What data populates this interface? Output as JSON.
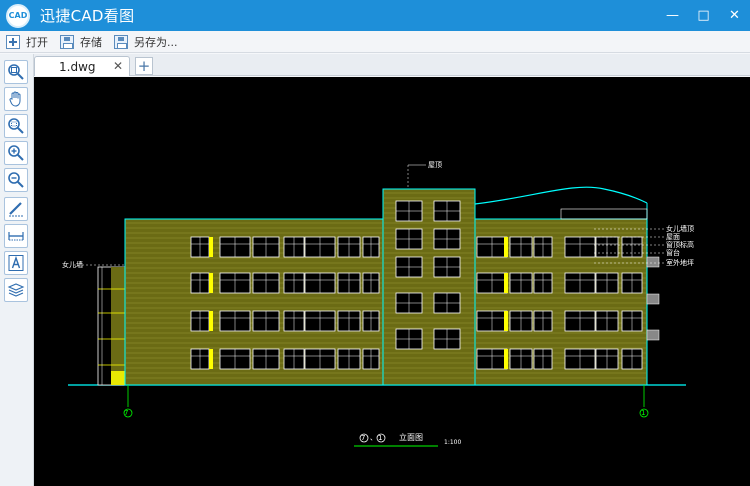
{
  "app": {
    "title": "迅捷CAD看图",
    "logo_text": "CAD"
  },
  "window_controls": {
    "minimize": "—",
    "maximize": "□",
    "close": "✕"
  },
  "toolbar": {
    "open_label": "打开",
    "save_label": "存储",
    "save_as_label": "另存为..."
  },
  "tabs": [
    {
      "label": "1.dwg",
      "close": "✕"
    }
  ],
  "new_tab": "+",
  "palette": [
    {
      "icon": "zoom-extents-icon"
    },
    {
      "icon": "pan-hand-icon"
    },
    {
      "icon": "zoom-window-icon"
    },
    {
      "icon": "zoom-in-icon"
    },
    {
      "icon": "zoom-out-icon"
    },
    {
      "icon": "markup-pen-icon"
    },
    {
      "icon": "measure-icon"
    },
    {
      "icon": "text-icon"
    },
    {
      "icon": "layers-icon"
    }
  ],
  "colors": {
    "titlebar": "#1e8fd9",
    "canvas": "#000000",
    "facade": "#6b6b14",
    "outline": "#00ffff",
    "window": "#ffffff",
    "accent_yellow": "#ffff00",
    "grid_green": "#00ff00"
  },
  "drawing": {
    "grid_left": "7",
    "grid_right": "1",
    "title_grid_a": "7",
    "title_grid_b": "1",
    "title_sep": "、",
    "title_text": "立面图",
    "scale": "1:100",
    "top_note": "屋顶",
    "left_note": "女儿墙",
    "right_notes": [
      "女儿墙顶",
      "屋面",
      "窗顶标高",
      "窗台",
      "室外地坪"
    ]
  }
}
